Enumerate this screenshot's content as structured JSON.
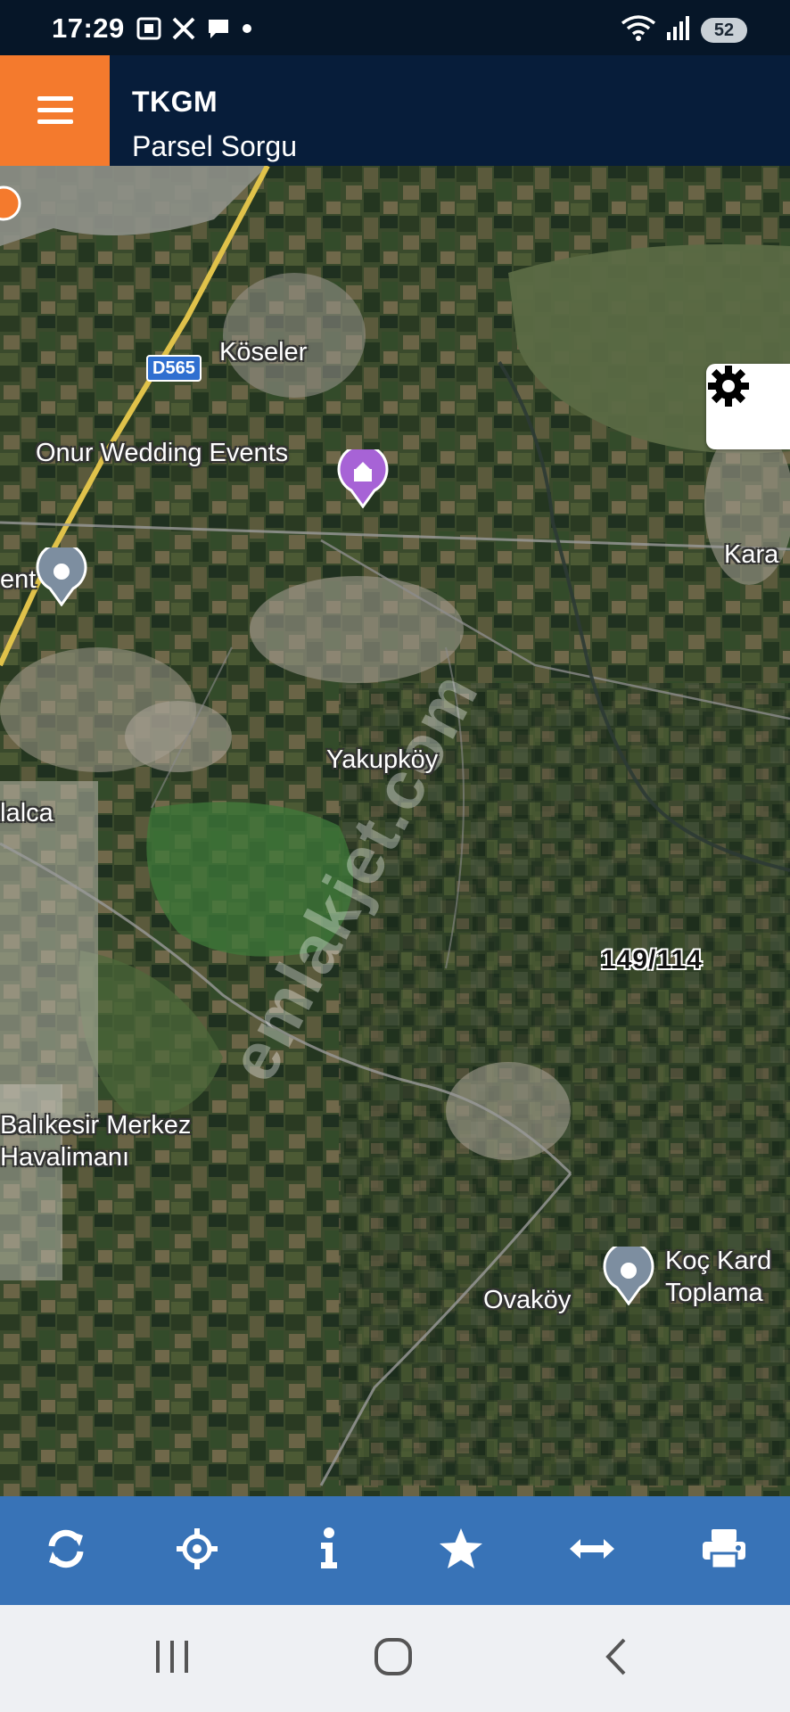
{
  "status_bar": {
    "time": "17:29",
    "notification_icons": [
      "screenshot-icon",
      "x-icon",
      "chat-icon",
      "dot-icon"
    ],
    "wifi_icon": "wifi-icon",
    "signal_icon": "signal-icon",
    "battery_level": "52"
  },
  "header": {
    "menu_icon": "hamburger-menu-icon",
    "title": "TKGM",
    "subtitle": "Parsel Sorgu",
    "menu_color": "#f47a2d",
    "bg_color": "#071d3a"
  },
  "map": {
    "settings_icon": "gear-icon",
    "road_shield": "D565",
    "labels": {
      "koseler": "Köseler",
      "onur": "Onur Wedding Events",
      "kara": "Kara",
      "ent": "ent",
      "yakupkoy": "Yakupköy",
      "alca": "alalca",
      "balikesir1": "Balıkesir Merkez",
      "balikesir2": "Havalimanı",
      "ovakoy": "Ovaköy",
      "koc1": "Koç Kard",
      "koc2": "Toplama"
    },
    "parcel": "149/114",
    "watermark": "emlakjet.com"
  },
  "toolbar": {
    "bg_color": "#3873b7",
    "tools": [
      "refresh-icon",
      "locate-icon",
      "info-icon",
      "favorite-star-icon",
      "measure-icon",
      "print-icon"
    ]
  },
  "nav": {
    "recents_icon": "recents-icon",
    "home_icon": "home-icon",
    "back_icon": "back-icon"
  }
}
